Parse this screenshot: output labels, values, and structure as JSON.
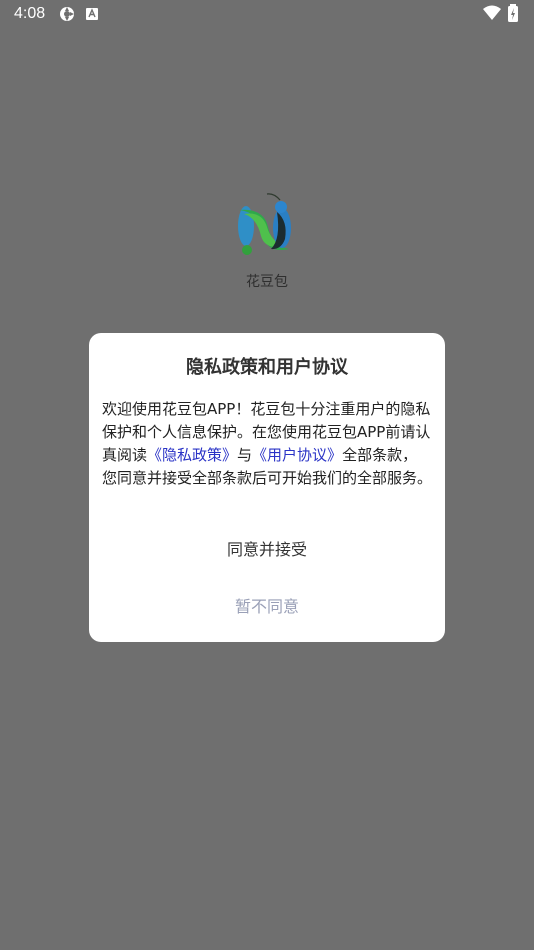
{
  "status_bar": {
    "time": "4:08",
    "icons": [
      "sync-icon",
      "app-notification-icon",
      "wifi-icon",
      "battery-icon"
    ]
  },
  "splash": {
    "app_name": "花豆包"
  },
  "dialog": {
    "title": "隐私政策和用户协议",
    "body_before": "欢迎使用花豆包APP！花豆包十分注重用户的隐私保护和个人信息保护。在您使用花豆包APP前请认真阅读",
    "privacy_link": "《隐私政策》",
    "connector": "与",
    "agreement_link": "《用户协议》",
    "body_after": "全部条款，您同意并接受全部条款后可开始我们的全部服务。",
    "agree_label": "同意并接受",
    "disagree_label": "暂不同意"
  },
  "colors": {
    "overlay": "#6f6f6f",
    "link": "#2a33c6",
    "disagree_text": "#9aa0b7"
  }
}
